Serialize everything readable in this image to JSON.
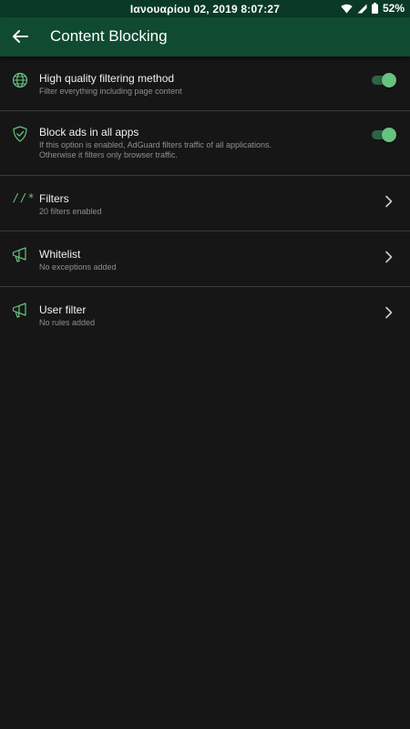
{
  "status_bar": {
    "time": "Ιανουαρίου 02, 2019 8:07:27",
    "battery": "52%"
  },
  "app_bar": {
    "title": "Content Blocking"
  },
  "rows": [
    {
      "title": "High quality filtering method",
      "subtitle": "Filter everything including page content",
      "icon": "globe-icon",
      "toggle_on": true
    },
    {
      "title": "Block ads in all apps",
      "subtitle_line1": "If this option is enabled, AdGuard filters traffic of all applications.",
      "subtitle_line2": "Otherwise it filters only browser traffic.",
      "icon": "shield-check-icon",
      "toggle_on": true
    },
    {
      "title": "Filters",
      "subtitle": "20 filters enabled",
      "icon_text": "//*",
      "icon": "filters-icon"
    },
    {
      "title": "Whitelist",
      "subtitle": "No exceptions added",
      "icon": "megaphone-icon"
    },
    {
      "title": "User filter",
      "subtitle": "No rules added",
      "icon": "megaphone-icon"
    }
  ],
  "colors": {
    "accent": "#67c27f",
    "status_bar": "#0a3a27",
    "app_bar": "#0f4a31",
    "background": "#161616"
  }
}
